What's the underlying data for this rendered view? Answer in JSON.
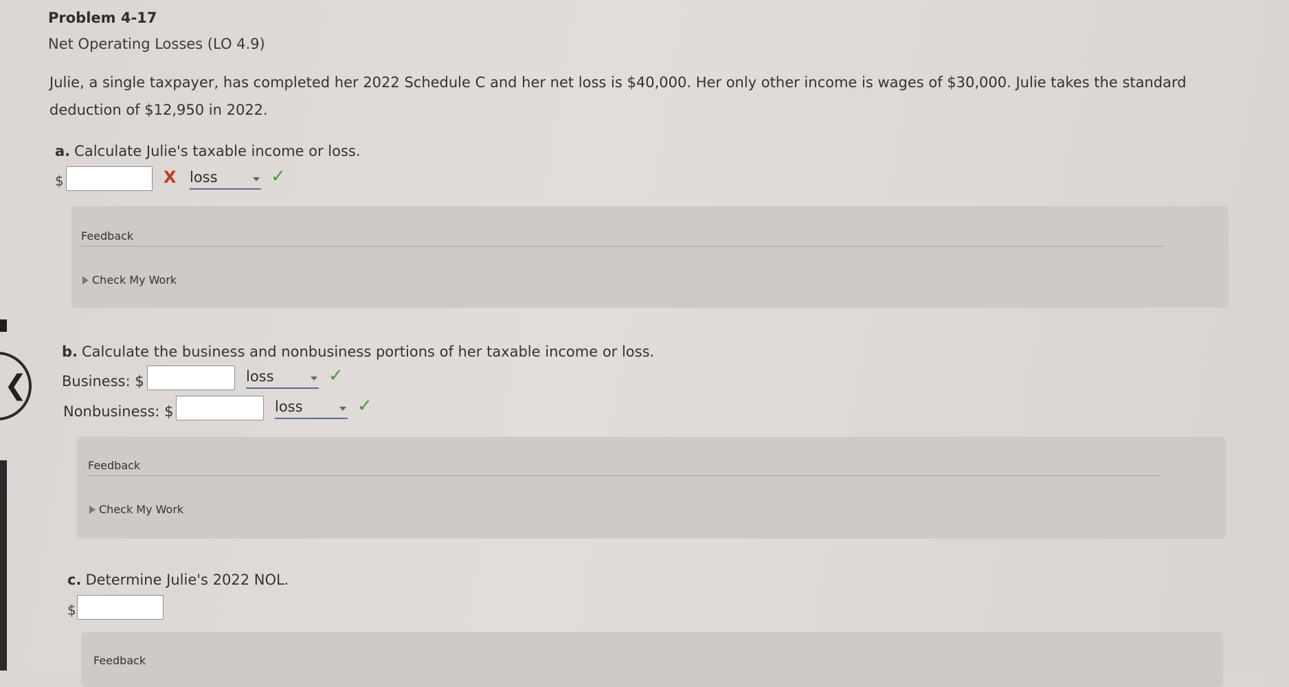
{
  "header": {
    "title": "Problem 4-17",
    "subtitle": "Net Operating Losses (LO 4.9)"
  },
  "problem_text": "Julie, a single taxpayer, has completed her 2022 Schedule C and her net loss is $40,000. Her only other income is wages of $30,000. Julie takes the standard deduction of $12,950 in 2022.",
  "part_a": {
    "letter": "a.",
    "question": "Calculate Julie's taxable income or loss.",
    "currency": "$",
    "input_value": "",
    "wrong_mark": "X",
    "select_value": "loss",
    "correct_mark": "✓"
  },
  "feedback_a": {
    "label": "Feedback",
    "check_my_work": "Check My Work"
  },
  "part_b": {
    "letter": "b.",
    "question": "Calculate the business and nonbusiness portions of her taxable income or loss.",
    "business_label": "Business: $",
    "business_value": "",
    "business_select": "loss",
    "nonbusiness_label": "Nonbusiness: $",
    "nonbusiness_value": "",
    "nonbusiness_select": "loss",
    "correct_mark": "✓"
  },
  "feedback_b": {
    "label": "Feedback",
    "check_my_work": "Check My Work"
  },
  "part_c": {
    "letter": "c.",
    "question": "Determine Julie's 2022 NOL.",
    "currency": "$",
    "input_value": ""
  },
  "feedback_c": {
    "label": "Feedback"
  },
  "colors": {
    "check": "#4a9a3a",
    "error": "#c0392b",
    "panel": "#cfc9c8"
  }
}
